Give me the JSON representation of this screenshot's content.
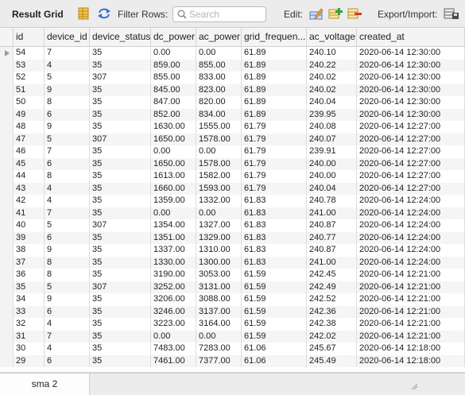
{
  "toolbar": {
    "title": "Result Grid",
    "filter_label": "Filter Rows:",
    "search_placeholder": "Search",
    "edit_label": "Edit:",
    "export_label": "Export/Import:"
  },
  "grid": {
    "columns": [
      "id",
      "device_id",
      "device_status",
      "dc_power",
      "ac_power",
      "grid_frequen...",
      "ac_voltage",
      "created_at"
    ],
    "rows": [
      [
        "54",
        "7",
        "35",
        "0.00",
        "0.00",
        "61.89",
        "240.10",
        "2020-06-14 12:30:00"
      ],
      [
        "53",
        "4",
        "35",
        "859.00",
        "855.00",
        "61.89",
        "240.22",
        "2020-06-14 12:30:00"
      ],
      [
        "52",
        "5",
        "307",
        "855.00",
        "833.00",
        "61.89",
        "240.02",
        "2020-06-14 12:30:00"
      ],
      [
        "51",
        "9",
        "35",
        "845.00",
        "823.00",
        "61.89",
        "240.02",
        "2020-06-14 12:30:00"
      ],
      [
        "50",
        "8",
        "35",
        "847.00",
        "820.00",
        "61.89",
        "240.04",
        "2020-06-14 12:30:00"
      ],
      [
        "49",
        "6",
        "35",
        "852.00",
        "834.00",
        "61.89",
        "239.95",
        "2020-06-14 12:30:00"
      ],
      [
        "48",
        "9",
        "35",
        "1630.00",
        "1555.00",
        "61.79",
        "240.08",
        "2020-06-14 12:27:00"
      ],
      [
        "47",
        "5",
        "307",
        "1650.00",
        "1578.00",
        "61.79",
        "240.07",
        "2020-06-14 12:27:00"
      ],
      [
        "46",
        "7",
        "35",
        "0.00",
        "0.00",
        "61.79",
        "239.91",
        "2020-06-14 12:27:00"
      ],
      [
        "45",
        "6",
        "35",
        "1650.00",
        "1578.00",
        "61.79",
        "240.00",
        "2020-06-14 12:27:00"
      ],
      [
        "44",
        "8",
        "35",
        "1613.00",
        "1582.00",
        "61.79",
        "240.00",
        "2020-06-14 12:27:00"
      ],
      [
        "43",
        "4",
        "35",
        "1660.00",
        "1593.00",
        "61.79",
        "240.04",
        "2020-06-14 12:27:00"
      ],
      [
        "42",
        "4",
        "35",
        "1359.00",
        "1332.00",
        "61.83",
        "240.78",
        "2020-06-14 12:24:00"
      ],
      [
        "41",
        "7",
        "35",
        "0.00",
        "0.00",
        "61.83",
        "241.00",
        "2020-06-14 12:24:00"
      ],
      [
        "40",
        "5",
        "307",
        "1354.00",
        "1327.00",
        "61.83",
        "240.87",
        "2020-06-14 12:24:00"
      ],
      [
        "39",
        "6",
        "35",
        "1351.00",
        "1329.00",
        "61.83",
        "240.77",
        "2020-06-14 12:24:00"
      ],
      [
        "38",
        "9",
        "35",
        "1337.00",
        "1310.00",
        "61.83",
        "240.87",
        "2020-06-14 12:24:00"
      ],
      [
        "37",
        "8",
        "35",
        "1330.00",
        "1300.00",
        "61.83",
        "241.00",
        "2020-06-14 12:24:00"
      ],
      [
        "36",
        "8",
        "35",
        "3190.00",
        "3053.00",
        "61.59",
        "242.45",
        "2020-06-14 12:21:00"
      ],
      [
        "35",
        "5",
        "307",
        "3252.00",
        "3131.00",
        "61.59",
        "242.49",
        "2020-06-14 12:21:00"
      ],
      [
        "34",
        "9",
        "35",
        "3206.00",
        "3088.00",
        "61.59",
        "242.52",
        "2020-06-14 12:21:00"
      ],
      [
        "33",
        "6",
        "35",
        "3246.00",
        "3137.00",
        "61.59",
        "242.36",
        "2020-06-14 12:21:00"
      ],
      [
        "32",
        "4",
        "35",
        "3223.00",
        "3164.00",
        "61.59",
        "242.38",
        "2020-06-14 12:21:00"
      ],
      [
        "31",
        "7",
        "35",
        "0.00",
        "0.00",
        "61.59",
        "242.02",
        "2020-06-14 12:21:00"
      ],
      [
        "30",
        "4",
        "35",
        "7483.00",
        "7283.00",
        "61.06",
        "245.67",
        "2020-06-14 12:18:00"
      ],
      [
        "29",
        "6",
        "35",
        "7461.00",
        "7377.00",
        "61.06",
        "245.49",
        "2020-06-14 12:18:00"
      ]
    ]
  },
  "footer": {
    "tab_label": "sma 2"
  }
}
